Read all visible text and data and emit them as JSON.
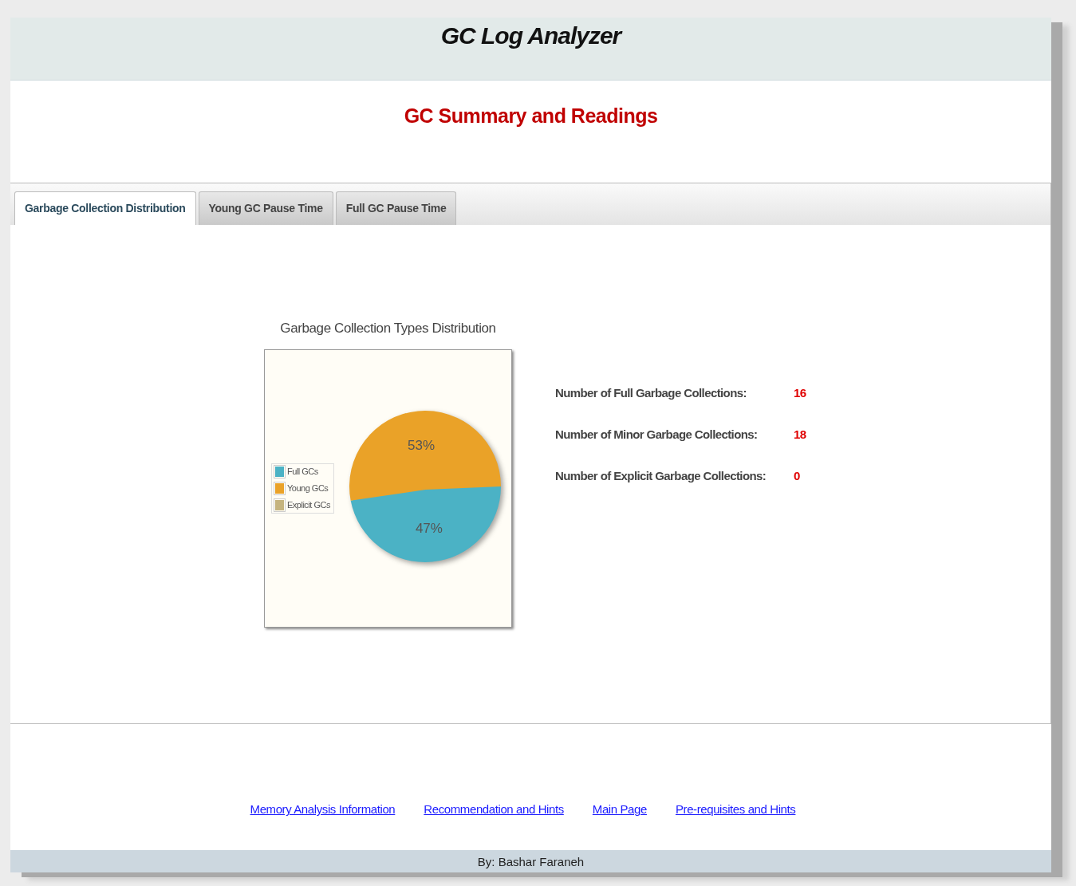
{
  "header": {
    "title": "GC Log Analyzer"
  },
  "subtitle": "GC Summary and Readings",
  "tabs": [
    {
      "label": "Garbage Collection Distribution",
      "selected": true
    },
    {
      "label": "Young GC Pause Time",
      "selected": false
    },
    {
      "label": "Full GC Pause Time",
      "selected": false
    }
  ],
  "chart": {
    "slices": [
      {
        "color": "#4bb2c5"
      },
      {
        "color": "#eaa228"
      },
      {
        "color": "#c5b47f"
      }
    ],
    "chart_data": {
      "type": "pie",
      "title": "Garbage Collection Types Distribution",
      "categories": [
        "Full GCs",
        "Young GCs",
        "Explicit GCs"
      ],
      "series": [
        {
          "values": [
            47,
            53,
            0
          ]
        }
      ],
      "value_labels": [
        "47%",
        "53%",
        null
      ],
      "legend": "left"
    }
  },
  "stats": [
    {
      "label": "Number of Full Garbage Collections:",
      "value": "16"
    },
    {
      "label": "Number of Minor Garbage Collections:",
      "value": "18"
    },
    {
      "label": "Number of Explicit Garbage Collections:",
      "value": "0"
    }
  ],
  "links": [
    "Memory Analysis Information",
    "Recommendation and Hints",
    "Main Page",
    "Pre-requisites and Hints"
  ],
  "footer": "By: Bashar Faraneh"
}
